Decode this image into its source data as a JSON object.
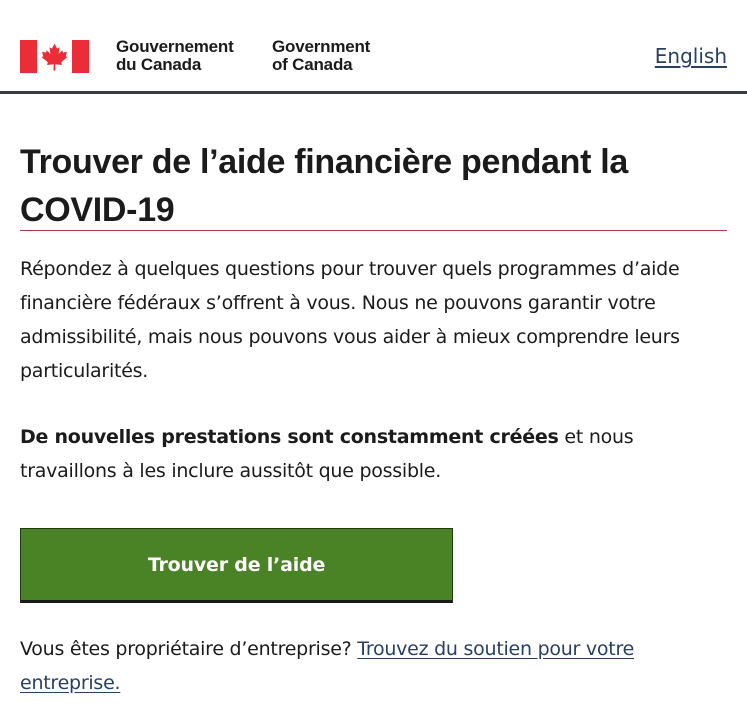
{
  "header": {
    "signature_fr_line1": "Gouvernement",
    "signature_fr_line2": "du Canada",
    "signature_en_line1": "Government",
    "signature_en_line2": "of Canada",
    "language_link": "English",
    "flag_icon": "canada-flag-icon",
    "flag_color": "#eb2d37"
  },
  "main": {
    "title_line1": "Trouver de l’aide financière pendant la",
    "title_line2": "COVID-19",
    "intro": "Répondez à quelques questions pour trouver quels programmes d’aide financière fédéraux s’offrent à vous. Nous ne pouvons garantir votre admissibilité, mais nous pouvons vous aider à mieux comprendre leurs particularités.",
    "notice_bold": "De nouvelles prestations sont constamment créées",
    "notice_rest": " et nous travaillons à les inclure aussitôt que possible.",
    "cta_label": "Trouver de l’aide",
    "business_text": "Vous êtes propriétaire d’entreprise? ",
    "business_link": "Trouvez du soutien pour votre entreprise."
  },
  "colors": {
    "accent_rule": "#af3c43",
    "button_green": "#4a8226",
    "link": "#284162",
    "header_rule": "#363d45"
  }
}
